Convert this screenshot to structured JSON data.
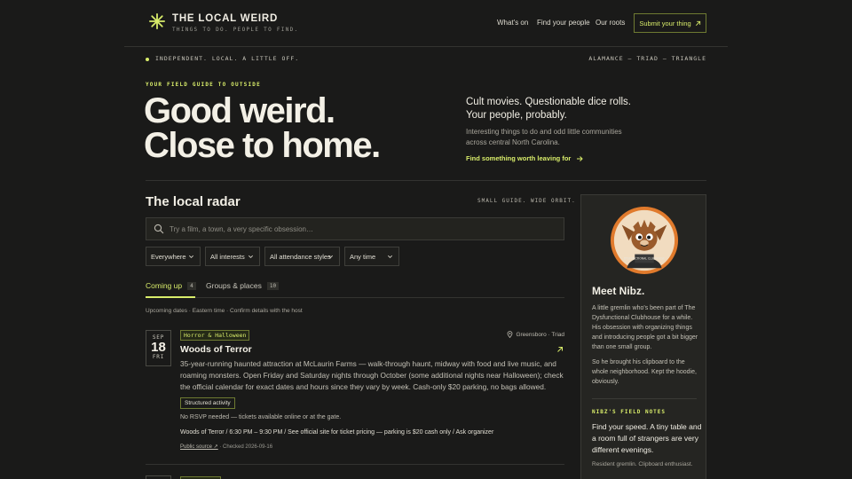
{
  "header": {
    "title": "THE LOCAL WEIRD",
    "tagline": "THINGS TO DO. PEOPLE TO FIND.",
    "nav": [
      "What's on",
      "Find your people",
      "Our roots"
    ],
    "submit_label": "Submit your thing"
  },
  "strip": {
    "left": "INDEPENDENT. LOCAL. A LITTLE OFF.",
    "right": "ALAMANCE — TRIAD — TRIANGLE"
  },
  "hero": {
    "eyebrow": "YOUR FIELD GUIDE TO OUTSIDE",
    "headline_1": "Good weird.",
    "headline_2": "Close to home.",
    "lead_1": "Cult movies. Questionable dice rolls.",
    "lead_2": "Your people, probably.",
    "sub": "Interesting things to do and odd little communities across central North Carolina.",
    "cta": "Find something worth leaving for"
  },
  "radar": {
    "title": "The local radar",
    "note": "SMALL GUIDE. WIDE ORBIT.",
    "search_placeholder": "Try a film, a town, a very specific obsession…",
    "filters": [
      "Everywhere",
      "All interests",
      "All attendance styles",
      "Any time"
    ],
    "tabs": [
      {
        "label": "Coming up",
        "count": "4"
      },
      {
        "label": "Groups & places",
        "count": "10"
      }
    ],
    "schedule_note": "Upcoming dates · Eastern time · Confirm details with the host"
  },
  "event": {
    "month": "SEP",
    "day": "18",
    "weekday": "FRI",
    "tag": "Horror & Halloween",
    "location": "Greensboro · Triad",
    "title": "Woods of Terror",
    "description": "35-year-running haunted attraction at McLaurin Farms — walk-through haunt, midway with food and live music, and roaming monsters. Open Friday and Saturday nights through October (some additional nights near Halloween); check the official calendar for exact dates and hours since they vary by week. Cash-only $20 parking, no bags allowed.",
    "activity_type": "Structured activity",
    "rsvp": "No RSVP needed — tickets available online or at the gate.",
    "meta": "Woods of Terror / 6:30 PM – 9:30 PM / See official site for ticket pricing — parking is $20 cash only / Ask organizer",
    "source_label": "Public source ↗",
    "checked": " · Checked 2026-09-16"
  },
  "sidebar": {
    "mascot_badge": "DYSFUNCTIONAL CLUBHOUSE",
    "title": "Meet Nibz.",
    "para_1": "A little gremlin who's been part of The Dysfunctional Clubhouse for a while. His obsession with organizing things and introducing people got a bit bigger than one small group.",
    "para_2": "So he brought his clipboard to the whole neighborhood. Kept the hoodie, obviously.",
    "notes_heading": "NIBZ'S FIELD NOTES",
    "notes_quote": "Find your speed. A tiny table and a room full of strangers are very different evenings.",
    "signature": "Resident gremlin. Clipboard enthusiast."
  },
  "colors": {
    "background": "#1a1a19",
    "accent": "#d8ec6a",
    "panel": "#252522"
  },
  "icons": [
    "sparkle-logo-icon",
    "arrow-up-right-icon",
    "arrow-right-icon",
    "search-icon",
    "chevron-down-icon",
    "map-pin-icon"
  ]
}
